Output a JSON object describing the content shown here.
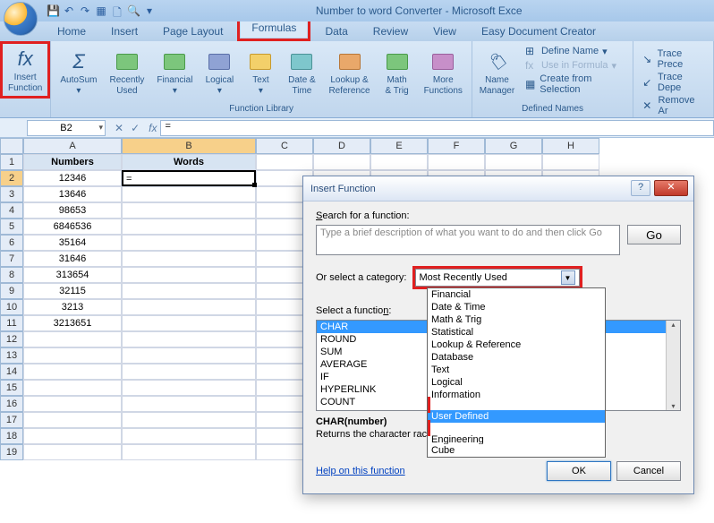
{
  "window": {
    "title": "Number to word Converter - Microsoft Exce"
  },
  "tabs": [
    "Home",
    "Insert",
    "Page Layout",
    "Formulas",
    "Data",
    "Review",
    "View",
    "Easy Document Creator"
  ],
  "ribbon": {
    "insert_function": "Insert\nFunction",
    "autosum": "AutoSum",
    "recently_used": "Recently\nUsed",
    "financial": "Financial",
    "logical": "Logical",
    "text": "Text",
    "date_time": "Date &\nTime",
    "lookup_ref": "Lookup &\nReference",
    "math_trig": "Math\n& Trig",
    "more_fn": "More\nFunctions",
    "name_mgr": "Name\nManager",
    "define_name": "Define Name",
    "use_in_formula": "Use in Formula",
    "create_sel": "Create from Selection",
    "trace_prec": "Trace Prece",
    "trace_dep": "Trace Depe",
    "remove_ar": "Remove Ar",
    "group_fl": "Function Library",
    "group_dn": "Defined Names"
  },
  "namebox": "B2",
  "formula": "=",
  "cols": [
    "A",
    "B",
    "C",
    "D",
    "E",
    "F",
    "G",
    "H"
  ],
  "data_rows": [
    {
      "n": "Numbers",
      "w": "Words",
      "hdr": true
    },
    {
      "n": "12346",
      "w": "="
    },
    {
      "n": "13646",
      "w": ""
    },
    {
      "n": "98653",
      "w": ""
    },
    {
      "n": "6846536",
      "w": ""
    },
    {
      "n": "35164",
      "w": ""
    },
    {
      "n": "31646",
      "w": ""
    },
    {
      "n": "313654",
      "w": ""
    },
    {
      "n": "32115",
      "w": ""
    },
    {
      "n": "3213",
      "w": ""
    },
    {
      "n": "3213651",
      "w": ""
    }
  ],
  "dialog": {
    "title": "Insert Function",
    "search_label": "Search for a function:",
    "search_placeholder": "Type a brief description of what you want to do and then click Go",
    "go": "Go",
    "cat_label": "Or select a category:",
    "cat_value": "Most Recently Used",
    "cat_options": [
      "Financial",
      "Date & Time",
      "Math & Trig",
      "Statistical",
      "Lookup & Reference",
      "Database",
      "Text",
      "Logical",
      "Information",
      "User Defined",
      "Engineering",
      "Cube"
    ],
    "sel_label": "Select a function:",
    "functions": [
      "CHAR",
      "ROUND",
      "SUM",
      "AVERAGE",
      "IF",
      "HYPERLINK",
      "COUNT"
    ],
    "signature": "CHAR(number)",
    "desc": "Returns the character                                                                         racter set for your computer.",
    "help": "Help on this function",
    "ok": "OK",
    "cancel": "Cancel"
  }
}
